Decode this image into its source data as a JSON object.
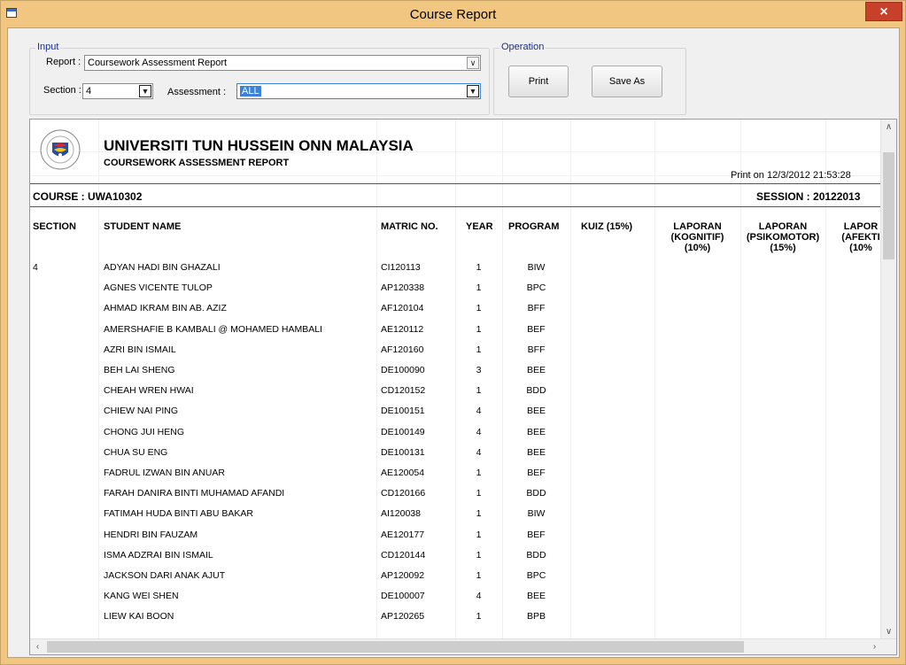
{
  "window": {
    "title": "Course Report",
    "close_label": "×"
  },
  "input": {
    "group_label": "Input",
    "report_label": "Report :",
    "report_value": "Coursework Assessment Report",
    "section_label": "Section :",
    "section_value": "4",
    "assessment_label": "Assessment :",
    "assessment_value": "ALL"
  },
  "operation": {
    "group_label": "Operation",
    "print_label": "Print",
    "save_as_label": "Save As"
  },
  "report": {
    "university": "UNIVERSITI TUN HUSSEIN ONN MALAYSIA",
    "title": "COURSEWORK ASSESSMENT REPORT",
    "print_on": "Print on 12/3/2012 21:53:28",
    "course": "COURSE : UWA10302",
    "session": "SESSION : 20122013",
    "headers": {
      "section": "SECTION",
      "student_name": "STUDENT NAME",
      "matric": "MATRIC NO.",
      "year": "YEAR",
      "program": "PROGRAM",
      "kuiz": "KUIZ (15%)",
      "lap1": [
        "LAPORAN",
        "(KOGNITIF)",
        "(10%)"
      ],
      "lap2": [
        "LAPORAN",
        "(PSIKOMOTOR)",
        "(15%)"
      ],
      "lap3": [
        "LAPOR",
        "(AFEKTI",
        "(10%"
      ]
    },
    "section_value": "4",
    "rows": [
      {
        "name": "ADYAN HADI BIN GHAZALI",
        "matric": "CI120113",
        "year": "1",
        "program": "BIW"
      },
      {
        "name": "AGNES VICENTE TULOP",
        "matric": "AP120338",
        "year": "1",
        "program": "BPC"
      },
      {
        "name": "AHMAD IKRAM BIN AB. AZIZ",
        "matric": "AF120104",
        "year": "1",
        "program": "BFF"
      },
      {
        "name": "AMERSHAFIE B KAMBALI @ MOHAMED HAMBALI",
        "matric": "AE120112",
        "year": "1",
        "program": "BEF"
      },
      {
        "name": "AZRI BIN ISMAIL",
        "matric": "AF120160",
        "year": "1",
        "program": "BFF"
      },
      {
        "name": "BEH LAI SHENG",
        "matric": "DE100090",
        "year": "3",
        "program": "BEE"
      },
      {
        "name": "CHEAH WREN HWAI",
        "matric": "CD120152",
        "year": "1",
        "program": "BDD"
      },
      {
        "name": "CHIEW NAI PING",
        "matric": "DE100151",
        "year": "4",
        "program": "BEE"
      },
      {
        "name": "CHONG JUI HENG",
        "matric": "DE100149",
        "year": "4",
        "program": "BEE"
      },
      {
        "name": "CHUA SU ENG",
        "matric": "DE100131",
        "year": "4",
        "program": "BEE"
      },
      {
        "name": "FADRUL IZWAN BIN ANUAR",
        "matric": "AE120054",
        "year": "1",
        "program": "BEF"
      },
      {
        "name": "FARAH DANIRA BINTI MUHAMAD AFANDI",
        "matric": "CD120166",
        "year": "1",
        "program": "BDD"
      },
      {
        "name": "FATIMAH HUDA BINTI ABU BAKAR",
        "matric": "AI120038",
        "year": "1",
        "program": "BIW"
      },
      {
        "name": "HENDRI BIN FAUZAM",
        "matric": "AE120177",
        "year": "1",
        "program": "BEF"
      },
      {
        "name": "ISMA ADZRAI BIN ISMAIL",
        "matric": "CD120144",
        "year": "1",
        "program": "BDD"
      },
      {
        "name": "JACKSON DARI ANAK AJUT",
        "matric": "AP120092",
        "year": "1",
        "program": "BPC"
      },
      {
        "name": "KANG WEI SHEN",
        "matric": "DE100007",
        "year": "4",
        "program": "BEE"
      },
      {
        "name": "LIEW KAI BOON",
        "matric": "AP120265",
        "year": "1",
        "program": "BPB"
      }
    ]
  }
}
